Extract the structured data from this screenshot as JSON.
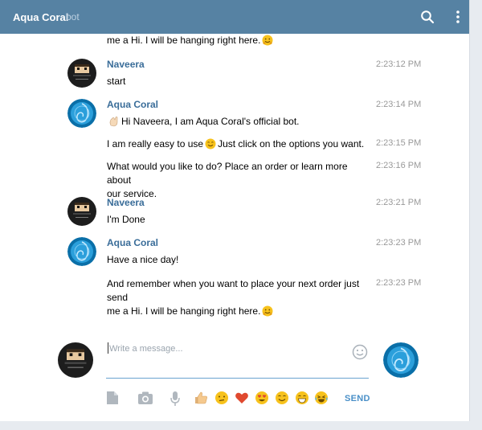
{
  "header": {
    "title": "Aqua Coral",
    "subtitle": "bot"
  },
  "messages": [
    {
      "text": "me a Hi. I will be hanging right here."
    },
    {
      "name": "Naveera",
      "text": "start",
      "time": "2:23:12 PM"
    },
    {
      "name": "Aqua Coral",
      "text": "Hi Naveera, I am Aqua Coral's official bot.",
      "time": "2:23:14 PM"
    },
    {
      "text_before": "I am really easy to use",
      "text_after": "Just click on the options you want.",
      "time": "2:23:15 PM"
    },
    {
      "line1": "What would you like to do? Place an order or learn more about",
      "line2": "our service.",
      "time": "2:23:16 PM"
    },
    {
      "name": "Naveera",
      "text": "I'm Done",
      "time": "2:23:21 PM"
    },
    {
      "name": "Aqua Coral",
      "text": "Have a nice day!",
      "time": "2:23:23 PM"
    },
    {
      "line1": "And remember when you want to place your next order just send",
      "line2": "me a Hi. I will be hanging right here.",
      "time": "2:23:23 PM"
    }
  ],
  "composer": {
    "placeholder": "Write a message...",
    "send_label": "SEND"
  },
  "icons": {
    "search": "search-icon",
    "menu": "more-vertical-icon",
    "smile": "emoji-picker-icon",
    "attach": "document-icon",
    "camera": "camera-icon",
    "mic": "microphone-icon",
    "quick_emoji": [
      "thumbs-up",
      "confused-face",
      "heart",
      "heart-eyes-face",
      "smiling-face",
      "grinning-face",
      "crying-laughing-face"
    ]
  },
  "colors": {
    "header_bg": "#5682a3",
    "name_color": "#3a6d99",
    "accent": "#4a90c8"
  }
}
